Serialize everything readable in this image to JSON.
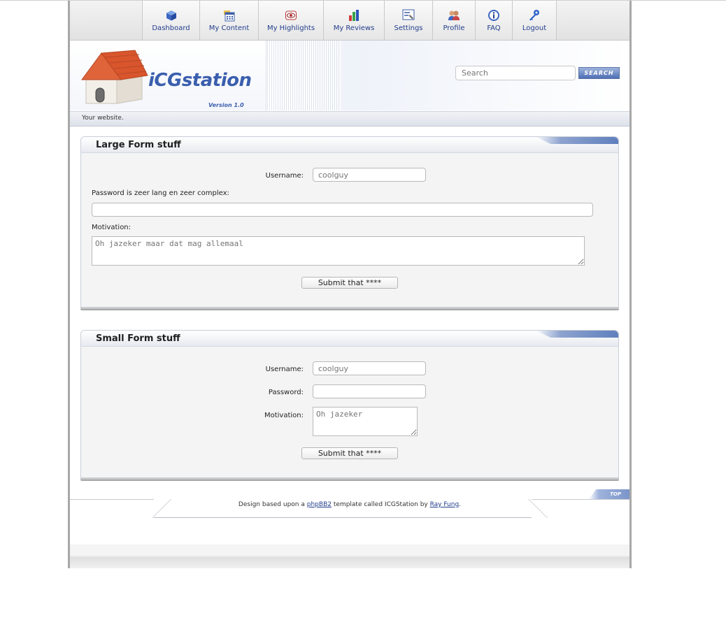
{
  "nav": {
    "items": [
      {
        "label": "Dashboard",
        "icon": "cube-icon"
      },
      {
        "label": "My Content",
        "icon": "calendar-folder-icon"
      },
      {
        "label": "My Highlights",
        "icon": "eye-icon"
      },
      {
        "label": "My Reviews",
        "icon": "bar-chart-icon"
      },
      {
        "label": "Settings",
        "icon": "settings-board-icon"
      },
      {
        "label": "Profile",
        "icon": "users-icon"
      },
      {
        "label": "FAQ",
        "icon": "info-icon"
      },
      {
        "label": "Logout",
        "icon": "key-icon"
      }
    ]
  },
  "header": {
    "logo_text": "iCGstation",
    "version": "Version 1.0",
    "search_placeholder": "Search",
    "search_button": "SEARCH",
    "tagline": "Your website."
  },
  "large_form": {
    "title": "Large Form stuff",
    "username_label": "Username:",
    "username_placeholder": "coolguy",
    "password_label": "Password is zeer lang en zeer complex:",
    "motivation_label": "Motivation:",
    "motivation_placeholder": "Oh jazeker maar dat mag allemaal",
    "submit": "Submit that ****"
  },
  "small_form": {
    "title": "Small Form stuff",
    "username_label": "Username:",
    "username_placeholder": "coolguy",
    "password_label": "Password:",
    "motivation_label": "Motivation:",
    "motivation_placeholder": "Oh jazeker",
    "submit": "Submit that ****"
  },
  "footer": {
    "top_button": "TOP",
    "credits_prefix": "Design based upon a",
    "phpbb_link": "phpBB2",
    "credits_middle": "template called ICGStation by",
    "author_link": "Ray Fung",
    "credits_suffix": "."
  },
  "colors": {
    "link": "#223d8c",
    "accent_blue": "#5f7fbd",
    "panel_bg": "#f4f4f4"
  }
}
